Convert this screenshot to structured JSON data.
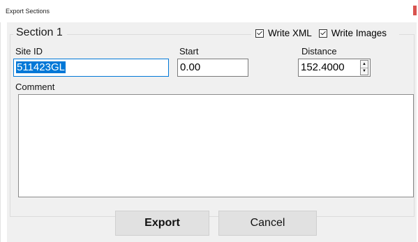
{
  "window": {
    "title": "Export Sections"
  },
  "section": {
    "title": "Section 1",
    "write_xml": {
      "label": "Write XML",
      "checked": true
    },
    "write_images": {
      "label": "Write Images",
      "checked": true
    }
  },
  "fields": {
    "site_id": {
      "label": "Site ID",
      "value": "511423GL"
    },
    "start": {
      "label": "Start",
      "value": "0.00"
    },
    "distance": {
      "label": "Distance",
      "value": "152.4000"
    },
    "comment": {
      "label": "Comment",
      "value": ""
    }
  },
  "buttons": {
    "export": "Export",
    "cancel": "Cancel"
  },
  "colors": {
    "selection": "#0078d7",
    "close_accent": "#d9534f"
  },
  "icons": {
    "spin_up": "▲",
    "spin_down": "▼"
  }
}
